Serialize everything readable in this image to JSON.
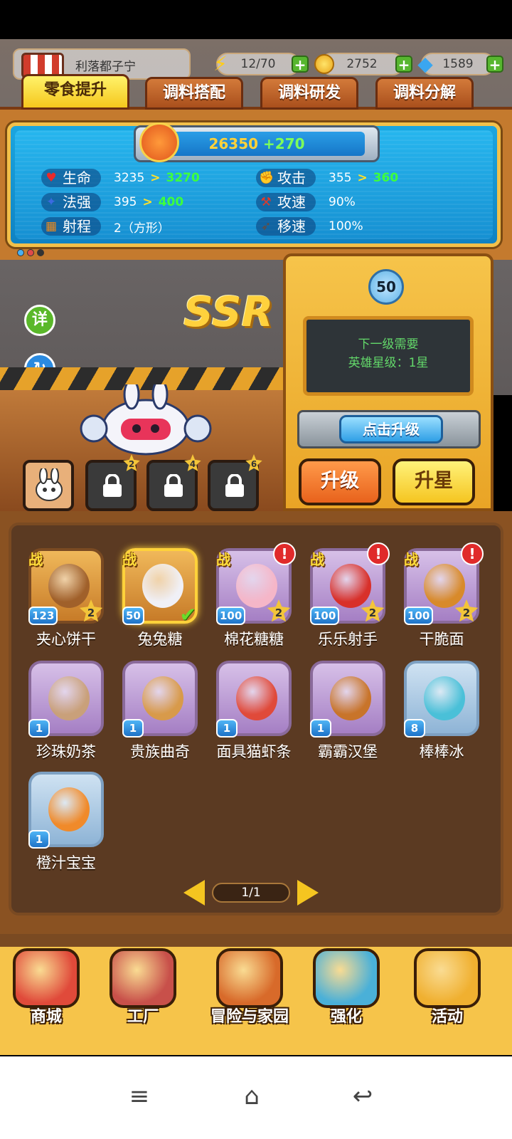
{
  "player": {
    "name": "利落都子宁"
  },
  "resources": {
    "energy": {
      "value": "12/70",
      "icon": "lightning-icon"
    },
    "coins": {
      "value": "2752",
      "icon": "coin-icon"
    },
    "gems": {
      "value": "1589",
      "icon": "diamond-icon"
    }
  },
  "tabs": [
    {
      "label": "零食提升",
      "active": true
    },
    {
      "label": "调料搭配",
      "active": false
    },
    {
      "label": "调料研发",
      "active": false
    },
    {
      "label": "调料分解",
      "active": false
    }
  ],
  "power": {
    "value": "26350",
    "bonus": "+270"
  },
  "stats": [
    {
      "label": "生命",
      "icon": "heart-icon",
      "current": "3235",
      "next": "3270"
    },
    {
      "label": "攻击",
      "icon": "fist-icon",
      "current": "355",
      "next": "360"
    },
    {
      "label": "法强",
      "icon": "magic-icon",
      "current": "395",
      "next": "400"
    },
    {
      "label": "攻速",
      "icon": "axe-icon",
      "current": "90%",
      "next": ""
    },
    {
      "label": "射程",
      "icon": "grid-icon",
      "current": "2（方形）",
      "next": ""
    },
    {
      "label": "移速",
      "icon": "boot-icon",
      "current": "100%",
      "next": ""
    }
  ],
  "side_buttons": {
    "detail": "详",
    "reset": "重置"
  },
  "rarity": "SSR",
  "hero_slots": [
    {
      "locked": false,
      "num": ""
    },
    {
      "locked": true,
      "num": "2"
    },
    {
      "locked": true,
      "num": "4"
    },
    {
      "locked": true,
      "num": "6"
    }
  ],
  "machine": {
    "level": "50",
    "line1": "下一级需要",
    "line2": "英雄星级：1星",
    "click_upgrade": "点击升级",
    "upgrade": "升级",
    "star_up": "升星"
  },
  "snacks": [
    {
      "name": "夹心饼干",
      "level": "123",
      "stars": "2",
      "battle": true,
      "alert": false,
      "selected": false,
      "style": "brown",
      "color": "#a0602a"
    },
    {
      "name": "兔兔糖",
      "level": "50",
      "stars": "",
      "battle": true,
      "alert": false,
      "selected": true,
      "style": "brown",
      "color": "#f0f0f6"
    },
    {
      "name": "棉花糖糖",
      "level": "100",
      "stars": "2",
      "battle": true,
      "alert": true,
      "selected": false,
      "style": "purple",
      "color": "#f5b6c8"
    },
    {
      "name": "乐乐射手",
      "level": "100",
      "stars": "2",
      "battle": true,
      "alert": true,
      "selected": false,
      "style": "purple",
      "color": "#d8302a"
    },
    {
      "name": "干脆面",
      "level": "100",
      "stars": "2",
      "battle": true,
      "alert": true,
      "selected": false,
      "style": "purple",
      "color": "#d88a2a"
    },
    {
      "name": "珍珠奶茶",
      "level": "1",
      "stars": "",
      "battle": false,
      "alert": false,
      "selected": false,
      "style": "purple",
      "color": "#c9a07a"
    },
    {
      "name": "贵族曲奇",
      "level": "1",
      "stars": "",
      "battle": false,
      "alert": false,
      "selected": false,
      "style": "purple",
      "color": "#d89a4a"
    },
    {
      "name": "面具猫虾条",
      "level": "1",
      "stars": "",
      "battle": false,
      "alert": false,
      "selected": false,
      "style": "purple",
      "color": "#e04a3a"
    },
    {
      "name": "霸霸汉堡",
      "level": "1",
      "stars": "",
      "battle": false,
      "alert": false,
      "selected": false,
      "style": "purple",
      "color": "#c8742a"
    },
    {
      "name": "棒棒冰",
      "level": "8",
      "stars": "",
      "battle": false,
      "alert": false,
      "selected": false,
      "style": "blue",
      "color": "#4ac0d8"
    },
    {
      "name": "橙汁宝宝",
      "level": "1",
      "stars": "",
      "battle": false,
      "alert": false,
      "selected": false,
      "style": "blue",
      "color": "#f08a2a"
    }
  ],
  "battle_tag": "战",
  "pager": {
    "label": "1/1"
  },
  "nav": [
    {
      "label": "商城",
      "icon": "shop-cart-icon",
      "color": "#e04a3a"
    },
    {
      "label": "工厂",
      "icon": "factory-icon",
      "color": "#c8504a"
    },
    {
      "label": "冒险与家园",
      "icon": "adventure-icon",
      "color": "#d86a2a"
    },
    {
      "label": "强化",
      "icon": "robot-tv-icon",
      "color": "#4ab0d8"
    },
    {
      "label": "活动",
      "icon": "trumpet-icon",
      "color": "#f0b030"
    }
  ]
}
